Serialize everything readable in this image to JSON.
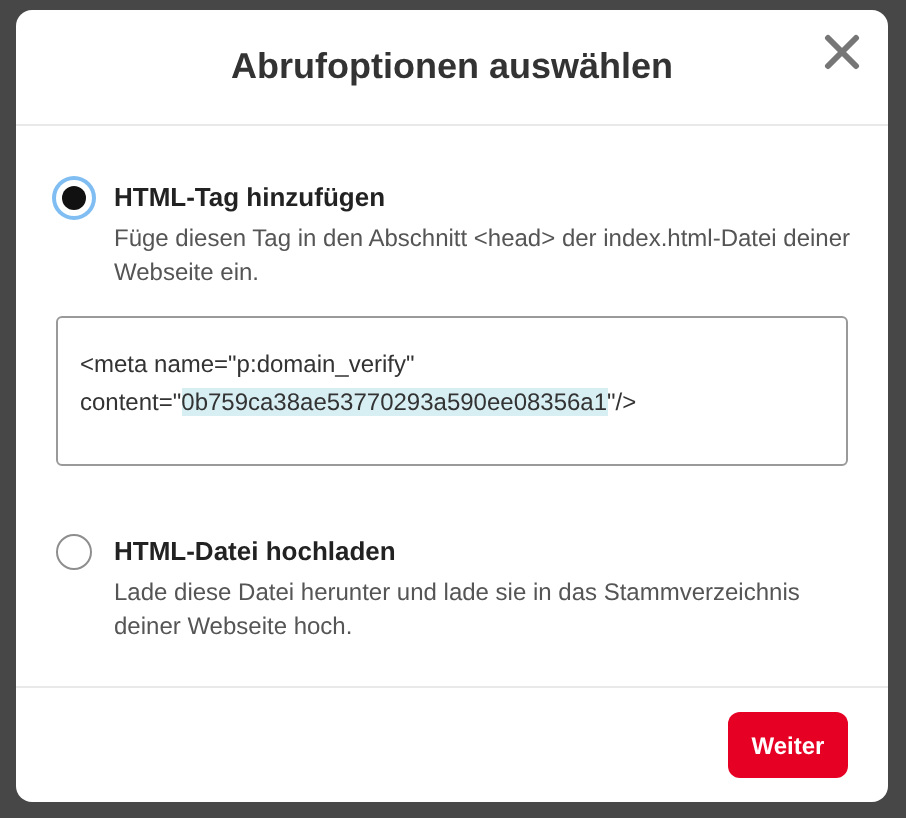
{
  "dialog": {
    "title": "Abrufoptionen auswählen"
  },
  "options": [
    {
      "label": "HTML-Tag hinzufügen",
      "description": "Füge diesen Tag in den Abschnitt <head> der index.html-Datei deiner Webseite ein.",
      "selected": true,
      "code": {
        "before": "<meta name=\"p:domain_verify\" content=\"",
        "highlighted": "0b759ca38ae53770293a590ee08356a1",
        "after": "\"/>"
      }
    },
    {
      "label": "HTML-Datei hochladen",
      "description": "Lade diese Datei herunter und lade sie in das Stammverzeichnis deiner Webseite hoch.",
      "selected": false
    }
  ],
  "footer": {
    "button": "Weiter"
  }
}
